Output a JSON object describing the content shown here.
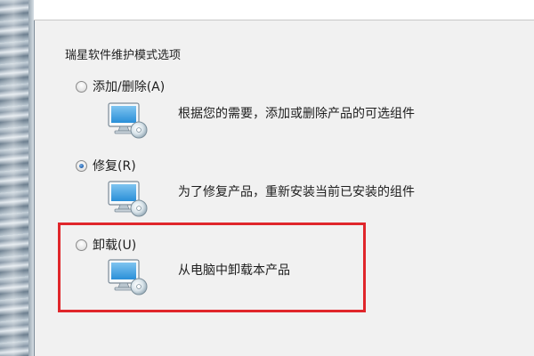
{
  "section": {
    "title": "瑞星软件维护模式选项"
  },
  "options": [
    {
      "label": "添加/删除(A)",
      "description": "根据您的需要，添加或删除产品的可选组件",
      "checked": false,
      "icon": "monitor-disc-icon"
    },
    {
      "label": "修复(R)",
      "description": "为了修复产品，重新安装当前已安装的组件",
      "checked": true,
      "icon": "monitor-disc-icon"
    },
    {
      "label": "卸载(U)",
      "description": "从电脑中卸载本产品",
      "checked": false,
      "icon": "monitor-disc-icon"
    }
  ],
  "colors": {
    "highlight": "#e0262b",
    "radio_selected": "#2c6bb5",
    "panel": "#f1f1f1"
  }
}
